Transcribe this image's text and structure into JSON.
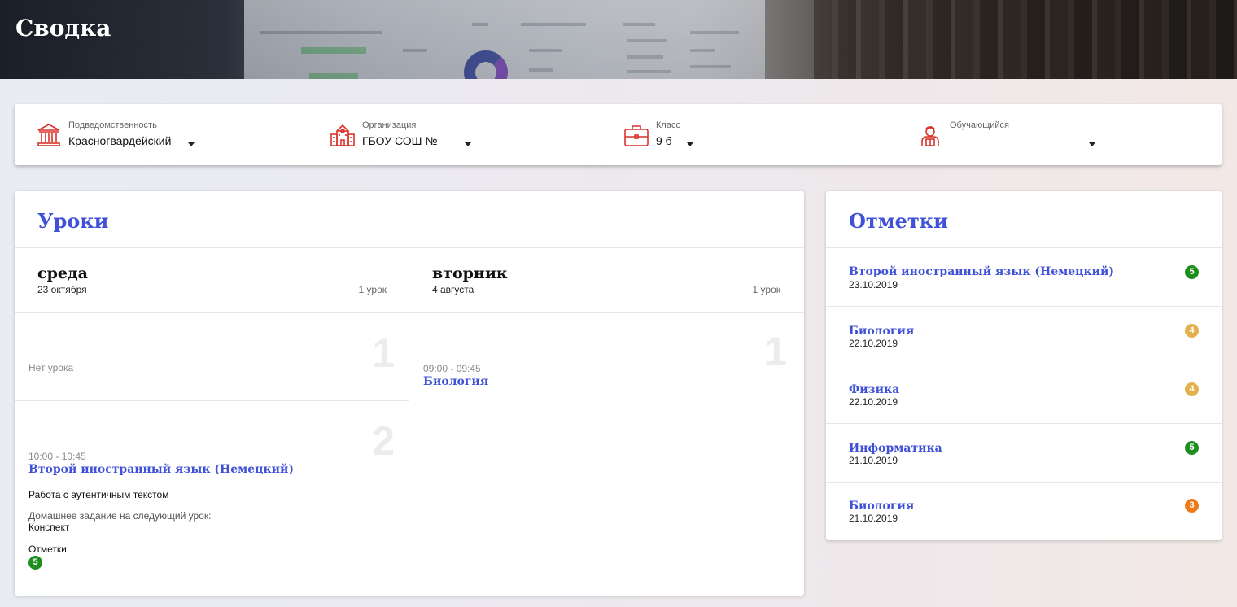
{
  "header": {
    "title": "Сводка"
  },
  "filters": [
    {
      "name": "subordination",
      "icon": "government-building-icon",
      "label": "Подведомственность",
      "value": "Красногвардейский"
    },
    {
      "name": "organization",
      "icon": "school-building-icon",
      "label": "Организация",
      "value": "ГБОУ СОШ №"
    },
    {
      "name": "class",
      "icon": "briefcase-icon",
      "label": "Класс",
      "value": "9 б"
    },
    {
      "name": "student",
      "icon": "student-icon",
      "label": "Обучающийся",
      "value": ""
    }
  ],
  "lessons": {
    "title": "Уроки",
    "days": [
      {
        "name": "среда",
        "date": "23 октября",
        "count": "1 урок",
        "slots": [
          {
            "number": "1",
            "empty_text": "Нет урока"
          },
          {
            "number": "2",
            "time": "10:00 - 10:45",
            "subject": "Второй иностранный язык (Немецкий)",
            "topic": "Работа с аутентичным текстом",
            "homework_label": "Домашнее задание на следующий урок:",
            "homework": "Конспект",
            "marks_label": "Отметки:",
            "mark": "5"
          }
        ]
      },
      {
        "name": "вторник",
        "date": "4 августа",
        "count": "1 урок",
        "slots": [
          {
            "number": "1",
            "time": "09:00 - 09:45",
            "subject": "Биология"
          }
        ]
      }
    ]
  },
  "marks": {
    "title": "Отметки",
    "items": [
      {
        "subject": "Второй иностранный язык (Немецкий)",
        "date": "23.10.2019",
        "grade": "5",
        "color": "#1e8e1e"
      },
      {
        "subject": "Биология",
        "date": "22.10.2019",
        "grade": "4",
        "color": "#e3b04b"
      },
      {
        "subject": "Физика",
        "date": "22.10.2019",
        "grade": "4",
        "color": "#e3b04b"
      },
      {
        "subject": "Информатика",
        "date": "21.10.2019",
        "grade": "5",
        "color": "#1e8e1e"
      },
      {
        "subject": "Биология",
        "date": "21.10.2019",
        "grade": "3",
        "color": "#ee7a1a"
      }
    ]
  },
  "colors": {
    "accent": "#3f51d6",
    "icon_red": "#d9342b",
    "grade_five": "#1e8e1e",
    "grade_four": "#e3b04b",
    "grade_three": "#ee7a1a"
  }
}
